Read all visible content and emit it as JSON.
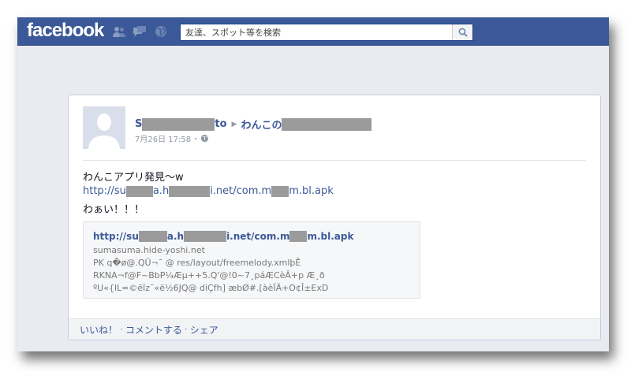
{
  "topbar": {
    "logo": "facebook",
    "search_placeholder": "友達、スポット等を検索",
    "icons": [
      "friends-icon",
      "messages-icon",
      "notifications-globe-icon",
      "search-icon"
    ]
  },
  "post": {
    "author_start": "S",
    "author_end": "to",
    "target_start": "わんこの",
    "timestamp": "7月26日 17:58",
    "timestamp_sep": "・",
    "message_line1": "わんこアプリ発見～w",
    "link_parts": [
      "http://su",
      "a.h",
      "i.net/com.m",
      "m.bl.apk"
    ],
    "message_line3": "わぁい！！！",
    "attachment": {
      "title_parts": [
        "http://su",
        "a.h",
        "i.net/com.m",
        "m.bl.apk"
      ],
      "domain": "sumasuma.hide-yoshi.net",
      "lines": [
        "PK q�ø@.QÜ¬¯ @ res/layout/freemelody.xmlþÊ",
        "RKNA¬f@F~BbP¼Æµ++5.Q'@!0~7¸páÆCèÂ+p Æ¸ð",
        "ºU«{lL=©ëîz¯«ë½6JQ@ diÇfh] æbØ#.[àèÏÄ+O¢Î±ExD"
      ]
    },
    "actions": [
      "いいね！",
      "コメントする",
      "シェア"
    ],
    "action_sep": "·"
  },
  "colors": {
    "brand": "#3b5998",
    "link": "#3b5998",
    "redaction": "#9b9b9b"
  }
}
